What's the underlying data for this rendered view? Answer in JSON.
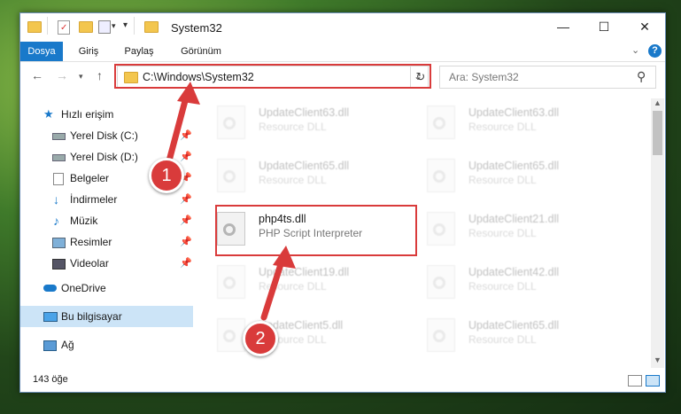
{
  "window": {
    "title": "System32",
    "controls": {
      "minimize": "—",
      "maximize": "☐",
      "close": "✕"
    }
  },
  "ribbon": {
    "tabs": [
      "Dosya",
      "Giriş",
      "Paylaş",
      "Görünüm"
    ],
    "collapse_icon": "chevron-down-icon",
    "help_icon": "?"
  },
  "address_bar": {
    "path": "C:\\Windows\\System32",
    "refresh_icon": "↻"
  },
  "search": {
    "placeholder": "Ara: System32",
    "icon": "⚲"
  },
  "nav_pane": {
    "items": [
      {
        "label": "Hızlı erişim",
        "icon": "star-icon"
      },
      {
        "label": "Yerel Disk (C:)",
        "icon": "drive-icon",
        "pinned": true
      },
      {
        "label": "Yerel Disk (D:)",
        "icon": "drive-icon",
        "pinned": true
      },
      {
        "label": "Belgeler",
        "icon": "document-icon",
        "pinned": true
      },
      {
        "label": "İndirmeler",
        "icon": "download-icon",
        "pinned": true
      },
      {
        "label": "Müzik",
        "icon": "music-icon",
        "pinned": true
      },
      {
        "label": "Resimler",
        "icon": "pictures-icon",
        "pinned": true
      },
      {
        "label": "Videolar",
        "icon": "video-icon",
        "pinned": true
      },
      {
        "label": "OneDrive",
        "icon": "cloud-icon"
      },
      {
        "label": "Bu bilgisayar",
        "icon": "computer-icon",
        "selected": true
      },
      {
        "label": "Ağ",
        "icon": "network-icon"
      }
    ]
  },
  "files": [
    {
      "name": "UpdateClient63.dll",
      "desc": "Resource DLL"
    },
    {
      "name": "UpdateClient63.dll",
      "desc": "Resource DLL"
    },
    {
      "name": "UpdateClient65.dll",
      "desc": "Resource DLL"
    },
    {
      "name": "UpdateClient65.dll",
      "desc": "Resource DLL"
    },
    {
      "name": "php4ts.dll",
      "desc": "PHP Script Interpreter"
    },
    {
      "name": "UpdateClient21.dll",
      "desc": "Resource DLL"
    },
    {
      "name": "UpdateClient19.dll",
      "desc": "Resource DLL"
    },
    {
      "name": "UpdateClient42.dll",
      "desc": "Resource DLL"
    },
    {
      "name": "UpdateClient5.dll",
      "desc": "Resource DLL"
    },
    {
      "name": "UpdateClient65.dll",
      "desc": "Resource DLL"
    }
  ],
  "status_bar": {
    "count": "143 öğe"
  },
  "callouts": [
    {
      "label": "1"
    },
    {
      "label": "2"
    }
  ],
  "colors": {
    "accent": "#1979ca",
    "callout": "#d93b3b",
    "selected": "#cce4f7"
  }
}
